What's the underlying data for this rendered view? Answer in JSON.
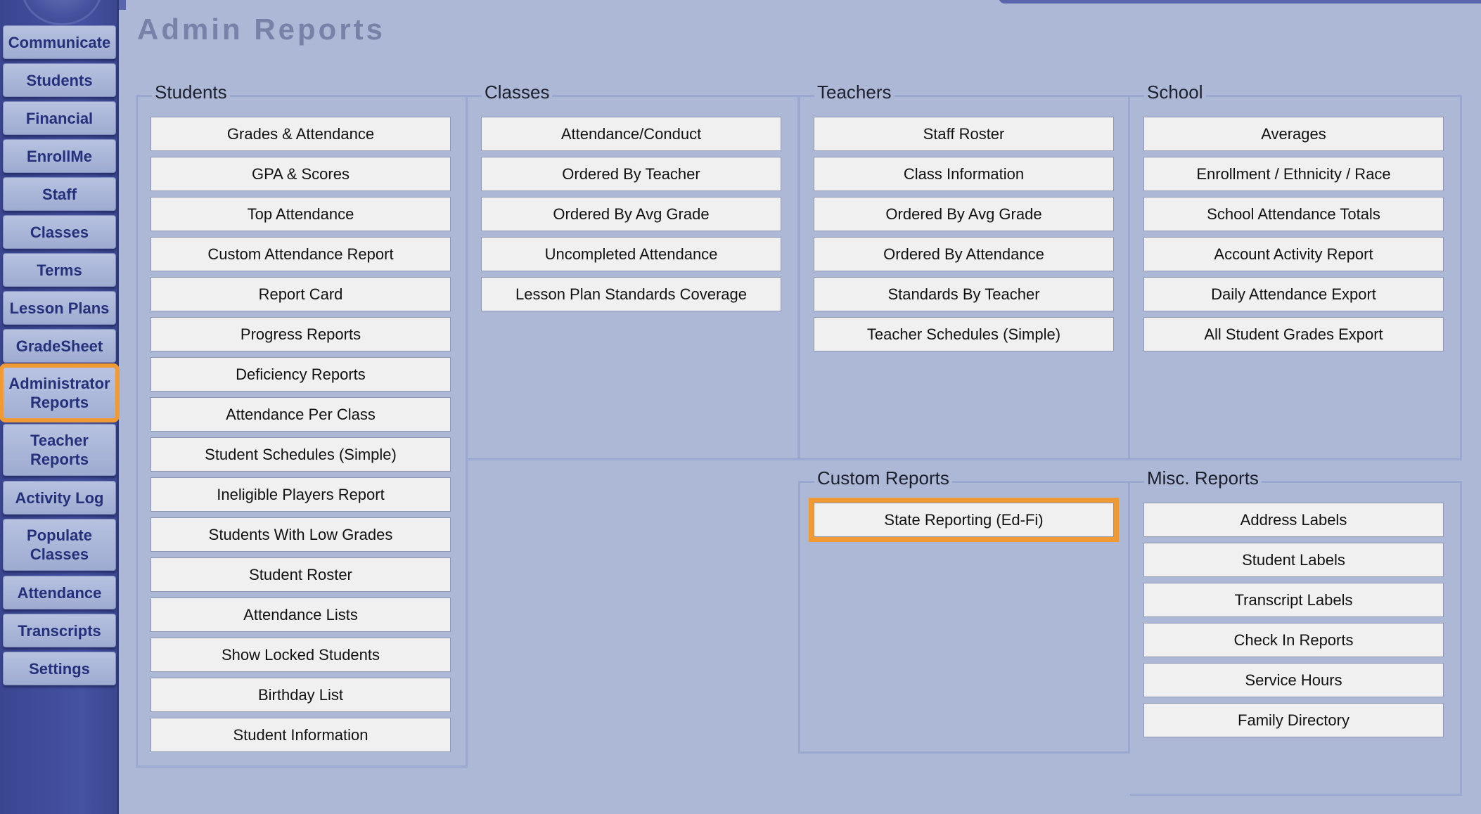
{
  "sidebar": {
    "items": [
      {
        "label": "Communicate"
      },
      {
        "label": "Students"
      },
      {
        "label": "Financial"
      },
      {
        "label": "EnrollMe"
      },
      {
        "label": "Staff"
      },
      {
        "label": "Classes"
      },
      {
        "label": "Terms"
      },
      {
        "label": "Lesson Plans"
      },
      {
        "label": "GradeSheet"
      },
      {
        "label": "Administrator Reports",
        "active": true
      },
      {
        "label": "Teacher Reports"
      },
      {
        "label": "Activity Log"
      },
      {
        "label": "Populate Classes"
      },
      {
        "label": "Attendance"
      },
      {
        "label": "Transcripts"
      },
      {
        "label": "Settings"
      }
    ]
  },
  "page": {
    "title": "Admin Reports"
  },
  "sections": {
    "students": {
      "title": "Students",
      "buttons": [
        "Grades & Attendance",
        "GPA & Scores",
        "Top Attendance",
        "Custom Attendance Report",
        "Report Card",
        "Progress Reports",
        "Deficiency Reports",
        "Attendance Per Class",
        "Student Schedules (Simple)",
        "Ineligible Players Report",
        "Students With Low Grades",
        "Student Roster",
        "Attendance Lists",
        "Show Locked Students",
        "Birthday List",
        "Student Information"
      ]
    },
    "classes": {
      "title": "Classes",
      "buttons": [
        "Attendance/Conduct",
        "Ordered By Teacher",
        "Ordered By Avg Grade",
        "Uncompleted Attendance",
        "Lesson Plan Standards Coverage"
      ]
    },
    "teachers": {
      "title": "Teachers",
      "buttons": [
        "Staff Roster",
        "Class Information",
        "Ordered By Avg Grade",
        "Ordered By Attendance",
        "Standards By Teacher",
        "Teacher Schedules (Simple)"
      ]
    },
    "school": {
      "title": "School",
      "buttons": [
        "Averages",
        "Enrollment / Ethnicity / Race",
        "School Attendance Totals",
        "Account Activity Report",
        "Daily Attendance Export",
        "All Student Grades Export"
      ]
    },
    "custom": {
      "title": "Custom Reports",
      "buttons": [
        "State Reporting (Ed-Fi)"
      ],
      "highlighted": "State Reporting (Ed-Fi)"
    },
    "misc": {
      "title": "Misc. Reports",
      "buttons": [
        "Address Labels",
        "Student Labels",
        "Transcript Labels",
        "Check In Reports",
        "Service Hours",
        "Family Directory"
      ]
    }
  },
  "colors": {
    "background": "#adb8d6",
    "sidebar": "#4552a2",
    "highlight": "#ef9a35",
    "title": "#7882a8"
  }
}
